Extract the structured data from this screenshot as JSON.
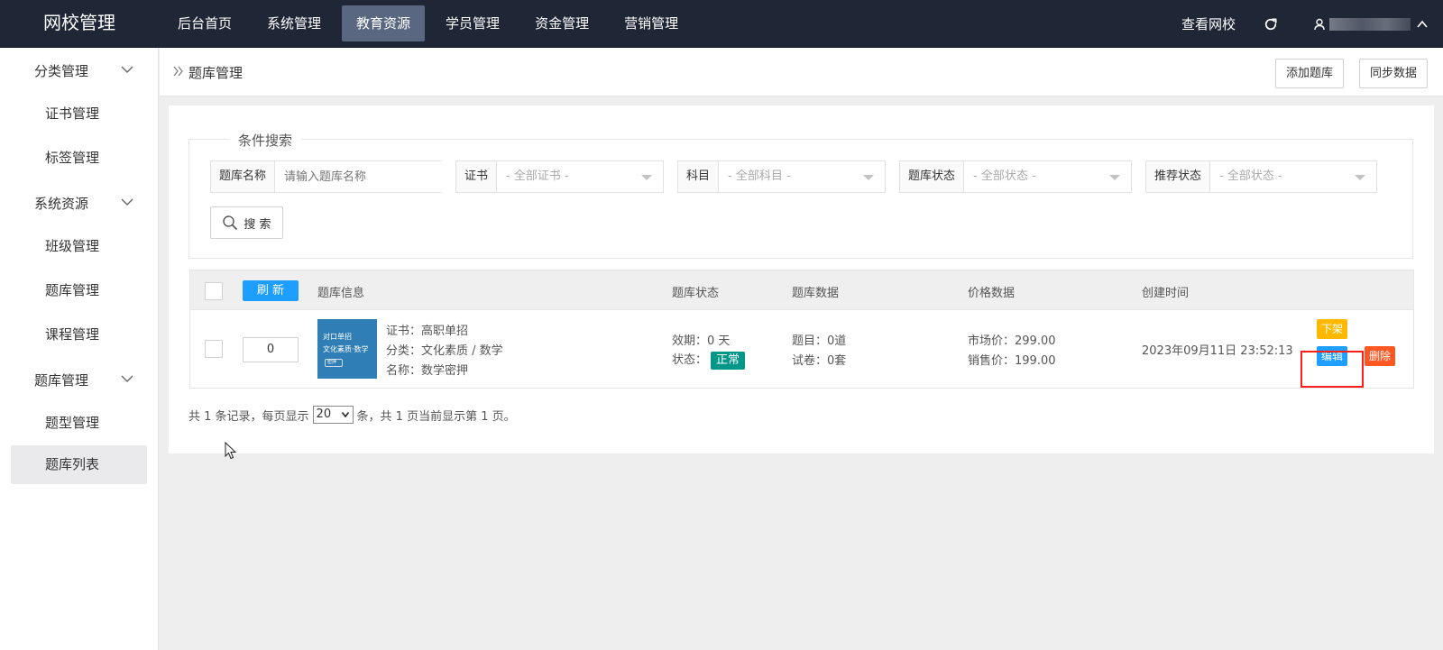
{
  "app": {
    "title": "网校管理"
  },
  "topnav": {
    "items": [
      {
        "label": "后台首页"
      },
      {
        "label": "系统管理"
      },
      {
        "label": "教育资源"
      },
      {
        "label": "学员管理"
      },
      {
        "label": "资金管理"
      },
      {
        "label": "营销管理"
      }
    ],
    "active": "教育资源",
    "view_site": "查看网校",
    "user_initial": "ዖ"
  },
  "sidebar": {
    "groups": [
      {
        "label": "分类管理",
        "items": [
          {
            "label": "证书管理"
          },
          {
            "label": "标签管理"
          }
        ]
      },
      {
        "label": "系统资源",
        "items": [
          {
            "label": "班级管理"
          },
          {
            "label": "题库管理"
          },
          {
            "label": "课程管理"
          }
        ]
      },
      {
        "label": "题库管理",
        "items": [
          {
            "label": "题型管理"
          },
          {
            "label": "题库列表"
          }
        ]
      }
    ],
    "active": "题库列表"
  },
  "header": {
    "breadcrumb": "题库管理",
    "add_label": "添加题库",
    "sync_label": "同步数据"
  },
  "search": {
    "legend": "条件搜索",
    "name_label": "题库名称",
    "name_placeholder": "请输入题库名称",
    "cert_label": "证书",
    "cert_value": "- 全部证书 -",
    "subject_label": "科目",
    "subject_value": "- 全部科目 -",
    "status_label": "题库状态",
    "status_value": "- 全部状态 -",
    "recommend_label": "推荐状态",
    "recommend_value": "- 全部状态 -",
    "button_label": "搜 索"
  },
  "table": {
    "refresh_label": "刷 新",
    "headers": {
      "info": "题库信息",
      "status": "题库状态",
      "data": "题库数据",
      "price": "价格数据",
      "created": "创建时间"
    },
    "rows": [
      {
        "sort": "0",
        "cover_lines": [
          "对口单招",
          "文化素质·数学",
          "密押"
        ],
        "cert": "证书：高职单招",
        "category": "分类：文化素质 / 数学",
        "name": "名称：数学密押",
        "validity": "效期：0 天",
        "status_prefix": "状态：",
        "status_badge": "正常",
        "questions": "题目：0道",
        "papers": "试卷：0套",
        "market_price": "市场价：299.00",
        "sale_price": "销售价：199.00",
        "created": "2023年09月11日 23:52:13",
        "actions": {
          "offshelf": "下架",
          "edit": "编辑",
          "delete": "删除"
        }
      }
    ]
  },
  "pager": {
    "prefix": "共 1 条记录，每页显示",
    "page_size": "20",
    "suffix": "条，共 1 页当前显示第 1 页。"
  },
  "colors": {
    "topbar": "#1f2636",
    "refresh_blue": "#1e9fff",
    "status_green": "#009688",
    "offshelf_yellow": "#ffb800",
    "delete_red": "#ff5722",
    "highlight_red": "#ff1d1d"
  }
}
